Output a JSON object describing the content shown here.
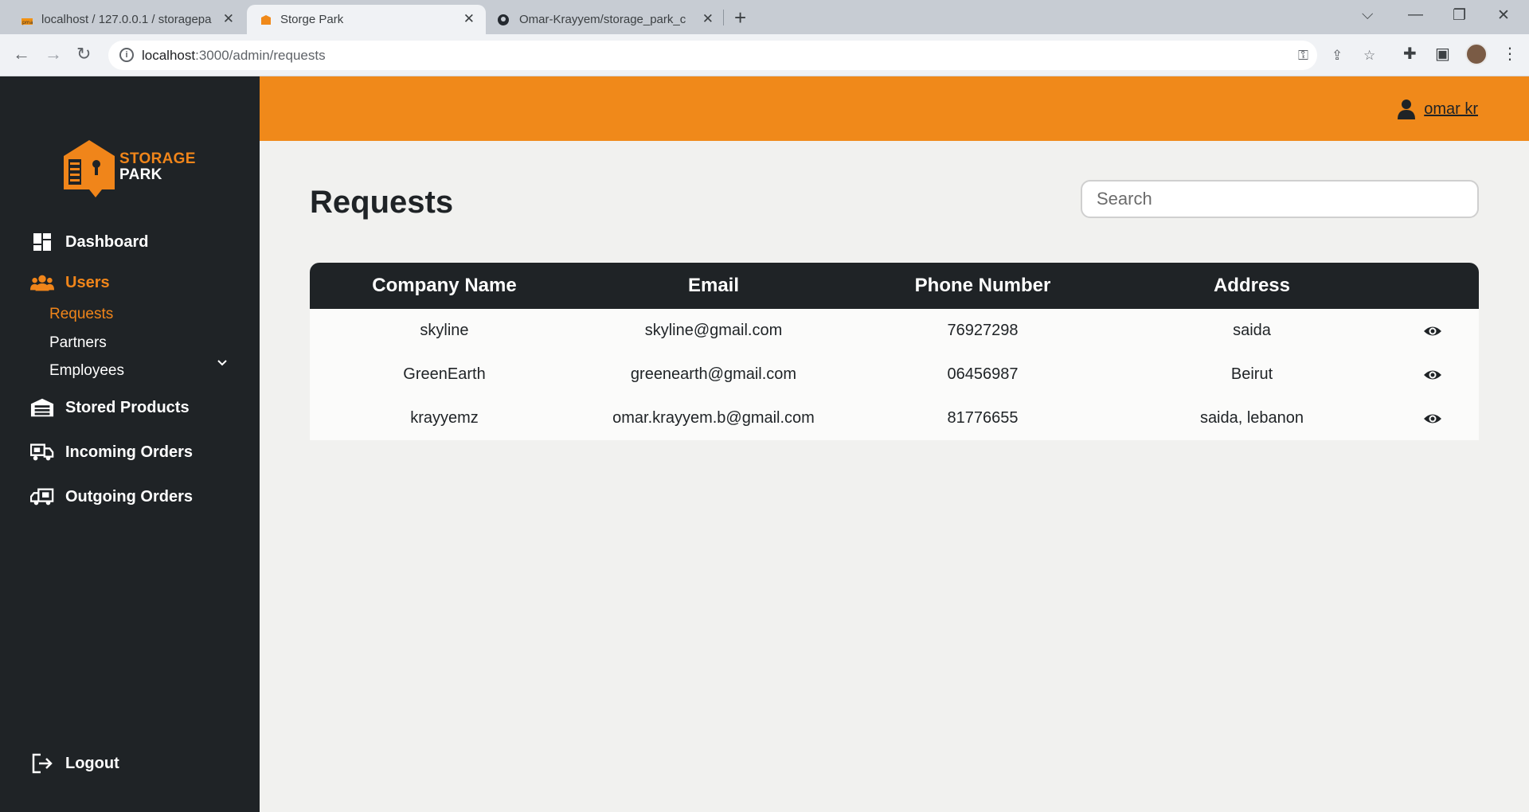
{
  "browser": {
    "tabs": [
      {
        "title": "localhost / 127.0.0.1 / storagepa"
      },
      {
        "title": "Storge Park"
      },
      {
        "title": "Omar-Krayyem/storage_park_cli"
      }
    ],
    "url_host": "localhost",
    "url_path": ":3000/admin/requests"
  },
  "sidebar": {
    "logo": {
      "line1": "STORAGE",
      "line2": "PARK"
    },
    "items": [
      {
        "label": "Dashboard",
        "icon": "dashboard-icon"
      },
      {
        "label": "Users",
        "icon": "users-icon"
      },
      {
        "label": "Stored Products",
        "icon": "warehouse-icon"
      },
      {
        "label": "Incoming Orders",
        "icon": "truck-loading-icon"
      },
      {
        "label": "Outgoing Orders",
        "icon": "truck-ramp-icon"
      }
    ],
    "users_sub": [
      {
        "label": "Requests"
      },
      {
        "label": "Partners"
      },
      {
        "label": "Employees"
      }
    ],
    "logout": "Logout"
  },
  "header": {
    "user_name": "omar kr"
  },
  "main": {
    "title": "Requests",
    "search_placeholder": "Search",
    "columns": [
      "Company Name",
      "Email",
      "Phone Number",
      "Address"
    ],
    "rows": [
      {
        "company": "skyline",
        "email": "skyline@gmail.com",
        "phone": "76927298",
        "address": "saida"
      },
      {
        "company": "GreenEarth",
        "email": "greenearth@gmail.com",
        "phone": "06456987",
        "address": "Beirut"
      },
      {
        "company": "krayyemz",
        "email": "omar.krayyem.b@gmail.com",
        "phone": "81776655",
        "address": "saida, lebanon"
      }
    ]
  },
  "colors": {
    "accent": "#f0891a",
    "sidebar": "#1f2326",
    "background": "#f1f1ef"
  }
}
